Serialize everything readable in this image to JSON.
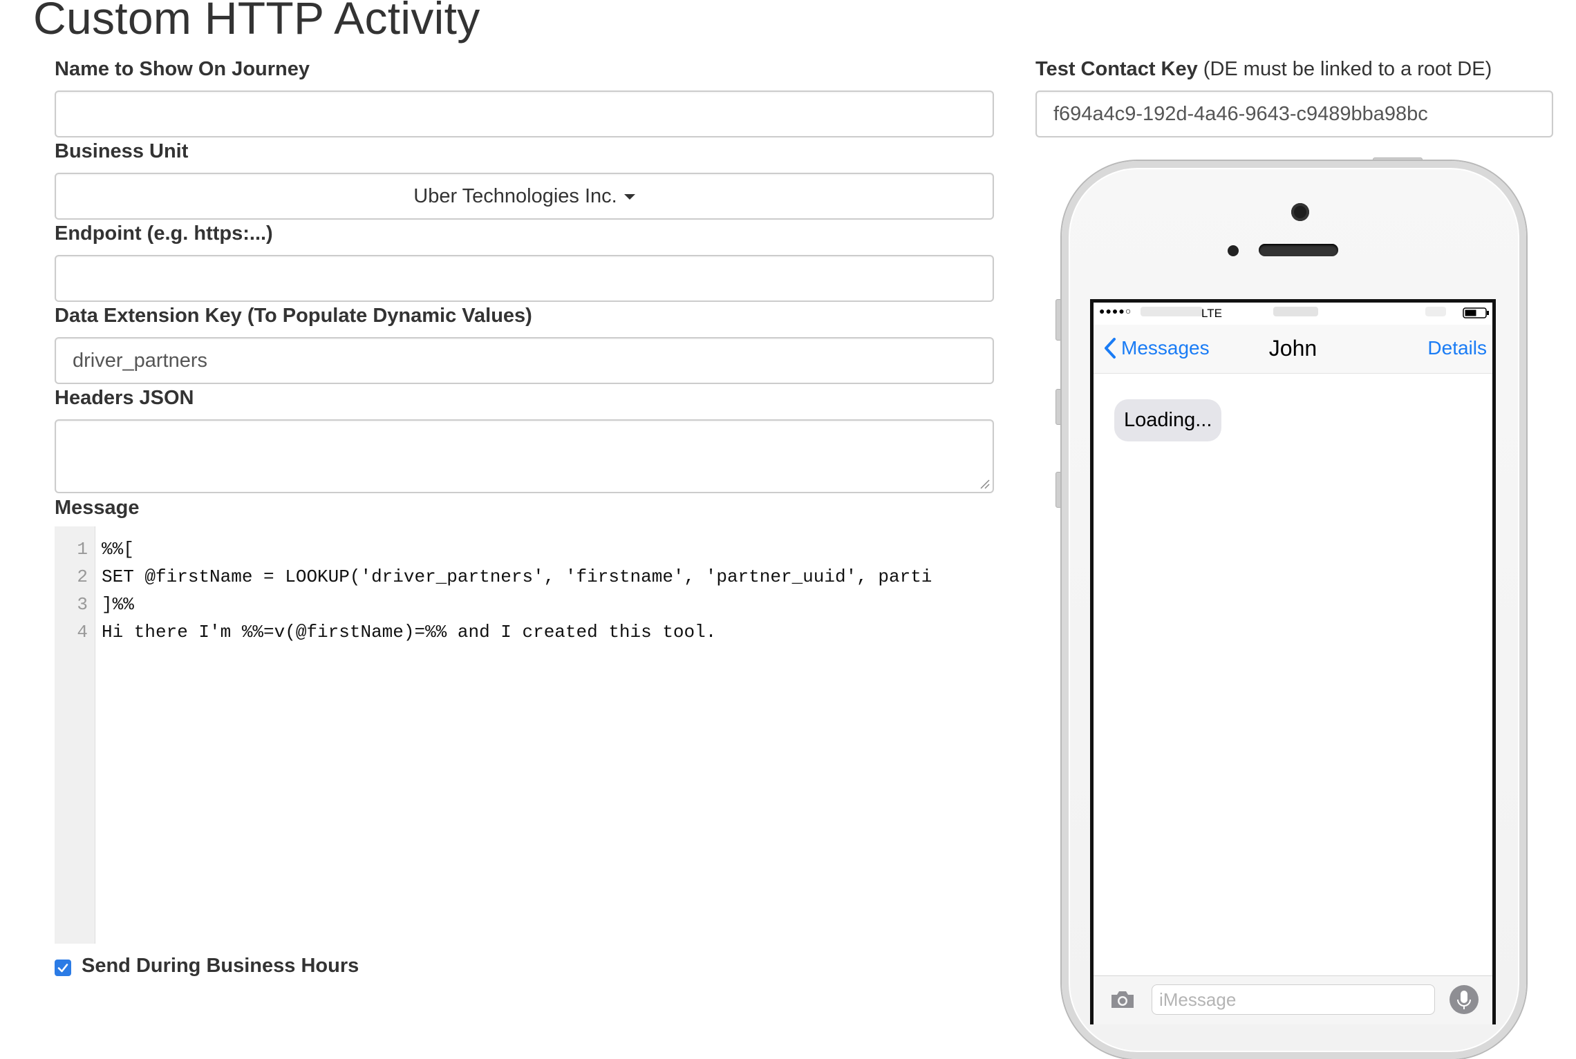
{
  "page": {
    "title": "Custom HTTP Activity"
  },
  "form": {
    "name_label": "Name to Show On Journey",
    "name_value": "",
    "business_unit_label": "Business Unit",
    "business_unit_value": "Uber Technologies Inc.",
    "endpoint_label": "Endpoint (e.g. https:...)",
    "endpoint_value": "",
    "de_key_label": "Data Extension Key (To Populate Dynamic Values)",
    "de_key_value": "driver_partners",
    "headers_label": "Headers JSON",
    "headers_value": "",
    "message_label": "Message",
    "business_hours_label": "Send During Business Hours",
    "business_hours_checked": true
  },
  "editor": {
    "lines": [
      {
        "num": "1",
        "text": "%%["
      },
      {
        "num": "2",
        "text": "SET @firstName = LOOKUP('driver_partners', 'firstname', 'partner_uuid', parti"
      },
      {
        "num": "3",
        "text": "]%%"
      },
      {
        "num": "4",
        "text": "Hi there I'm %%=v(@firstName)=%% and I created this tool."
      }
    ]
  },
  "test_contact": {
    "label_bold": "Test Contact Key",
    "label_note": "(DE must be linked to a root DE)",
    "value": "f694a4c9-192d-4a46-9643-c9489bba98bc"
  },
  "phone": {
    "status": {
      "signal": "●●●●○",
      "network": "LTE"
    },
    "nav": {
      "back": "Messages",
      "title": "John",
      "details": "Details"
    },
    "bubble": "Loading...",
    "input_placeholder": "iMessage"
  },
  "colors": {
    "accent": "#2b7be5",
    "ios_blue": "#1a7cf5",
    "bubble_gray": "#e5e5ea"
  },
  "icons": [
    "check-icon",
    "caret-down-icon",
    "chevron-left-icon",
    "camera-icon",
    "microphone-icon",
    "battery-icon"
  ]
}
